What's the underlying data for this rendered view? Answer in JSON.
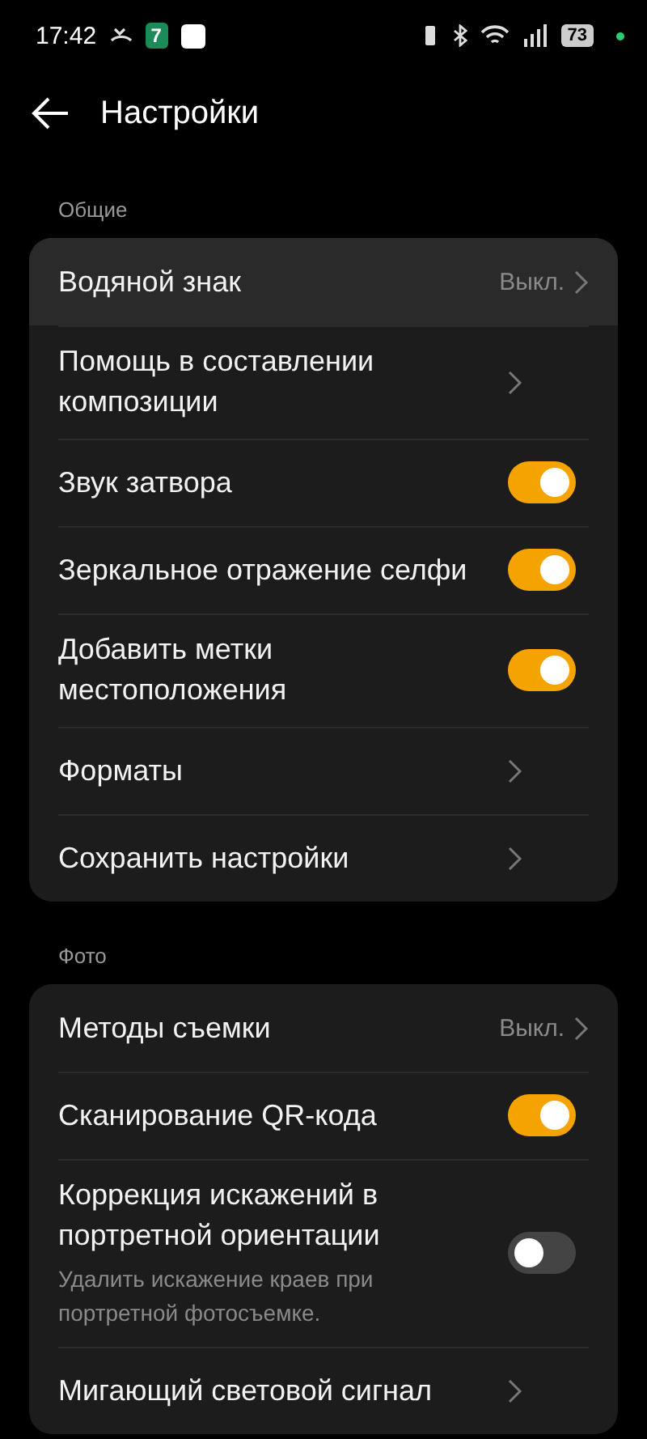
{
  "status_bar": {
    "time": "17:42",
    "notification_badge": "7",
    "battery": "73"
  },
  "header": {
    "title": "Настройки"
  },
  "sections": [
    {
      "title": "Общие",
      "items": [
        {
          "kind": "value",
          "label": "Водяной знак",
          "value": "Выкл.",
          "selected": true
        },
        {
          "kind": "link",
          "label": "Помощь в составлении композиции",
          "selected": false
        },
        {
          "kind": "toggle",
          "label": "Звук затвора",
          "on": true,
          "selected": false
        },
        {
          "kind": "toggle",
          "label": "Зеркальное отражение селфи",
          "on": true,
          "selected": false
        },
        {
          "kind": "toggle",
          "label": "Добавить метки местоположения",
          "on": true,
          "selected": false
        },
        {
          "kind": "link",
          "label": "Форматы",
          "selected": false
        },
        {
          "kind": "link",
          "label": "Сохранить настройки",
          "selected": false
        }
      ]
    },
    {
      "title": "Фото",
      "items": [
        {
          "kind": "value",
          "label": "Методы съемки",
          "value": "Выкл.",
          "selected": false
        },
        {
          "kind": "toggle",
          "label": "Сканирование QR-кода",
          "on": true,
          "selected": false
        },
        {
          "kind": "toggle",
          "label": "Коррекция искажений в портретной ориентации",
          "description": "Удалить искажение краев при портретной фотосъемке.",
          "on": false,
          "selected": false
        },
        {
          "kind": "link",
          "label": "Мигающий световой сигнал",
          "selected": false
        }
      ]
    }
  ]
}
